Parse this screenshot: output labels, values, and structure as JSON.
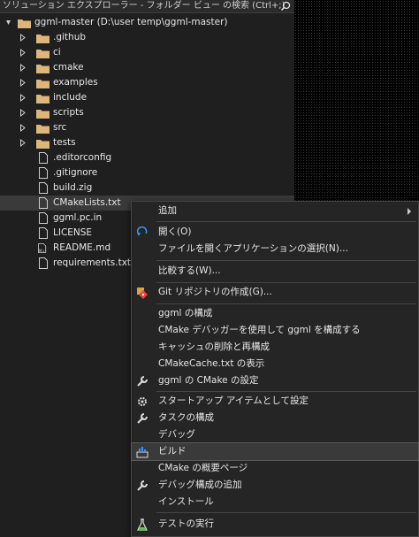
{
  "search": {
    "placeholder": "ソリューション エクスプローラー - フォルダー ビュー の検索 (Ctrl+;)"
  },
  "root": {
    "label": "ggml-master (D:\\user temp\\ggml-master)"
  },
  "folders": [
    {
      "label": ".github"
    },
    {
      "label": "ci"
    },
    {
      "label": "cmake"
    },
    {
      "label": "examples"
    },
    {
      "label": "include"
    },
    {
      "label": "scripts"
    },
    {
      "label": "src"
    },
    {
      "label": "tests"
    }
  ],
  "files": [
    {
      "label": ".editorconfig"
    },
    {
      "label": ".gitignore"
    },
    {
      "label": "build.zig"
    },
    {
      "label": "CMakeLists.txt",
      "selected": true
    },
    {
      "label": "ggml.pc.in"
    },
    {
      "label": "LICENSE"
    },
    {
      "label": "README.md"
    },
    {
      "label": "requirements.txt"
    }
  ],
  "menu": {
    "items": [
      {
        "label": "追加",
        "icon": "",
        "submenu": true
      },
      {
        "label": "開く(O)",
        "icon": "open-icon"
      },
      {
        "label": "ファイルを開くアプリケーションの選択(N)..."
      },
      {
        "label": "比較する(W)..."
      },
      {
        "label": "Git リポジトリの作成(G)...",
        "icon": "git-repo-icon"
      },
      {
        "label": "ggml の構成"
      },
      {
        "label": "CMake デバッガーを使用して ggml を構成する"
      },
      {
        "label": "キャッシュの削除と再構成"
      },
      {
        "label": "CMakeCache.txt の表示"
      },
      {
        "label": "ggml の CMake の設定",
        "icon": "wrench-icon"
      },
      {
        "label": "スタートアップ アイテムとして設定",
        "icon": "gear-icon"
      },
      {
        "label": "タスクの構成",
        "icon": "wrench-icon"
      },
      {
        "label": "デバッグ"
      },
      {
        "label": "ビルド",
        "icon": "build-icon",
        "highlighted": true
      },
      {
        "label": "CMake の概要ページ"
      },
      {
        "label": "デバッグ構成の追加",
        "icon": "wrench-icon"
      },
      {
        "label": "インストール"
      },
      {
        "label": "テストの実行",
        "icon": "test-flask-icon"
      }
    ]
  },
  "colors": {
    "folder": "#dcb67a",
    "accent": "#3794ff",
    "git_red": "#e8453c"
  }
}
